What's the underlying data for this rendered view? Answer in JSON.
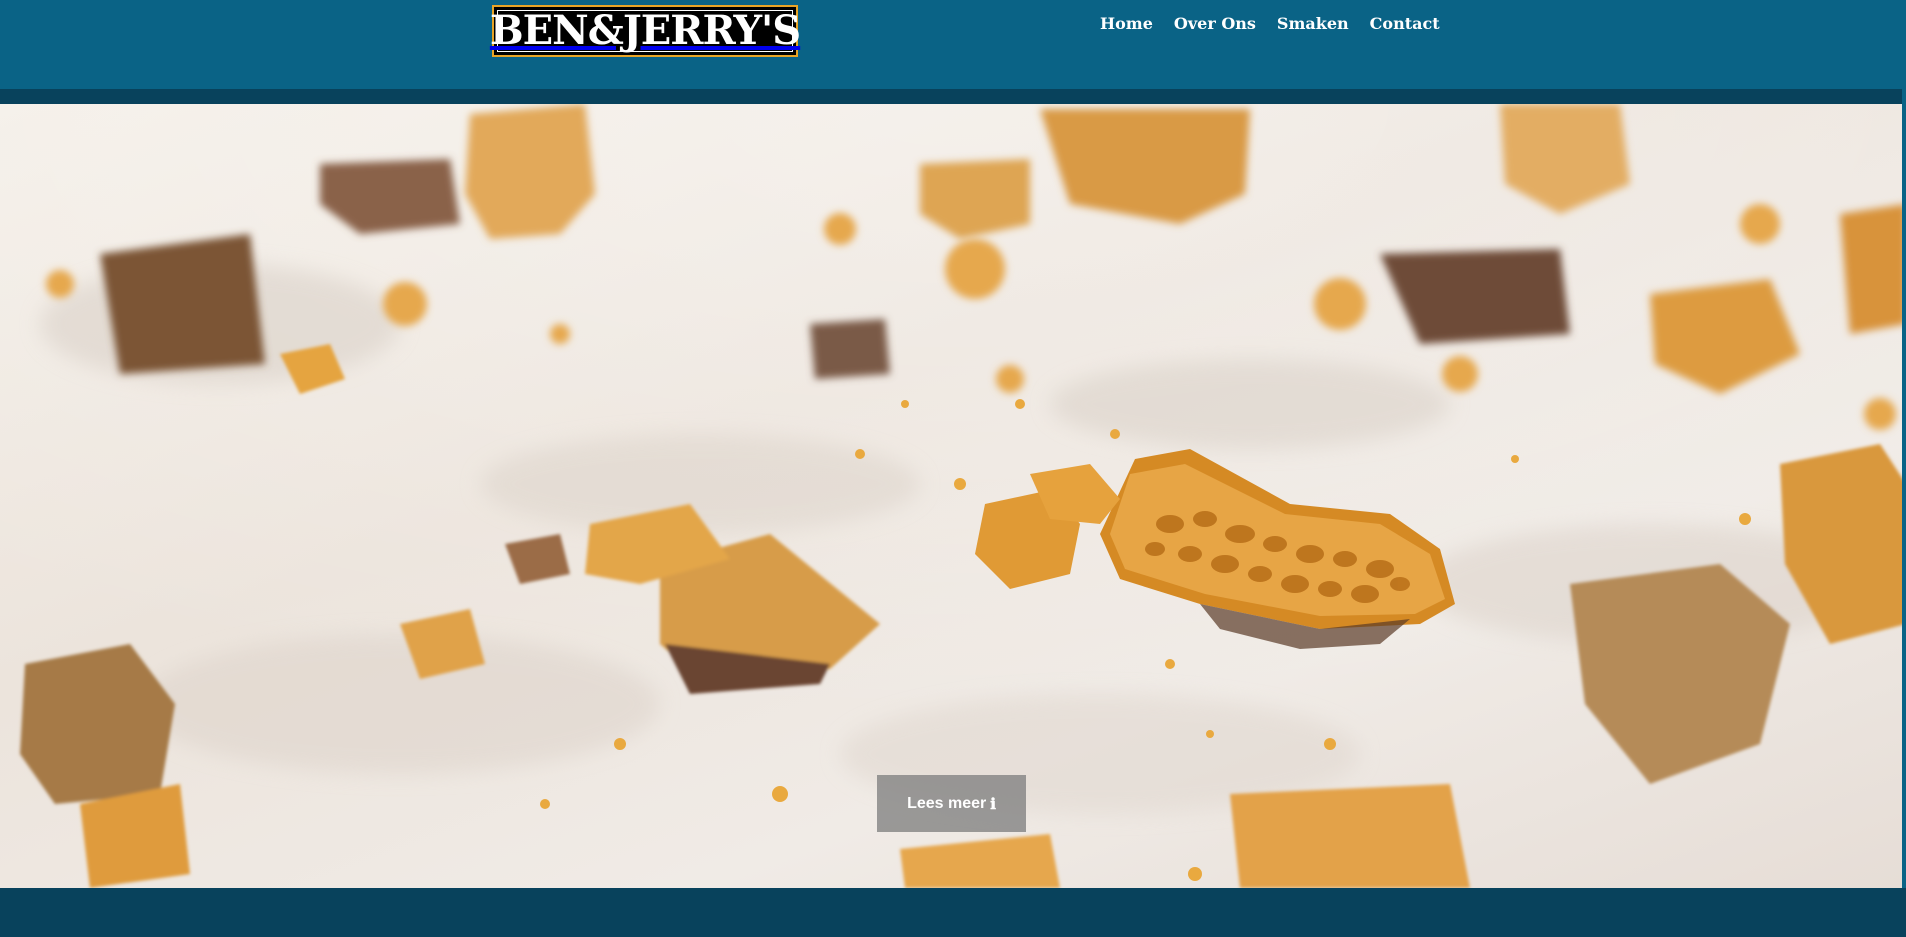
{
  "brand": {
    "logo_text": "BEN&JERRY'S",
    "logo_border_color": "#e8a426"
  },
  "nav": {
    "items": [
      {
        "label": "Home"
      },
      {
        "label": "Over Ons"
      },
      {
        "label": "Smaken"
      },
      {
        "label": "Contact"
      }
    ]
  },
  "hero": {
    "image": "ice-cream-with-honeycomb-pieces",
    "cta_label": "Lees meer",
    "cta_icon": "info-icon",
    "cta_glyph": "ℹ"
  },
  "colors": {
    "header": "#0a6386",
    "header_strip": "#08425c",
    "footer": "#08425c"
  }
}
